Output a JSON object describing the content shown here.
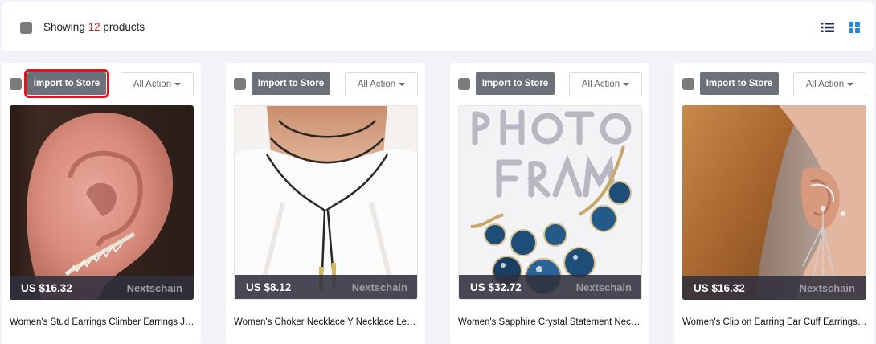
{
  "toolbar": {
    "showing_prefix": "Showing",
    "count": "12",
    "showing_suffix": "products",
    "accent_color": "#1e88e5",
    "count_color": "#e02020"
  },
  "products": [
    {
      "import_label": "Import to Store",
      "action_label": "All Action",
      "price": "US $16.32",
      "supplier": "Nextschain",
      "title": "Women's Stud Earrings Climber Earrings Jewelry",
      "image": "ear-climber-earring-photo"
    },
    {
      "import_label": "Import to Store",
      "action_label": "All Action",
      "price": "US $8.12",
      "supplier": "Nextschain",
      "title": "Women's Choker Necklace Y Necklace Leather",
      "image": "choker-necklace-photo"
    },
    {
      "import_label": "Import to Store",
      "action_label": "All Action",
      "price": "US $32.72",
      "supplier": "Nextschain",
      "title": "Women's Sapphire Crystal Statement Necklace",
      "image": "sapphire-necklace-photo"
    },
    {
      "import_label": "Import to Store",
      "action_label": "All Action",
      "price": "US $16.32",
      "supplier": "Nextschain",
      "title": "Women's Clip on Earring Ear Cuff Earrings Tassel",
      "image": "ear-cuff-earring-photo"
    }
  ]
}
